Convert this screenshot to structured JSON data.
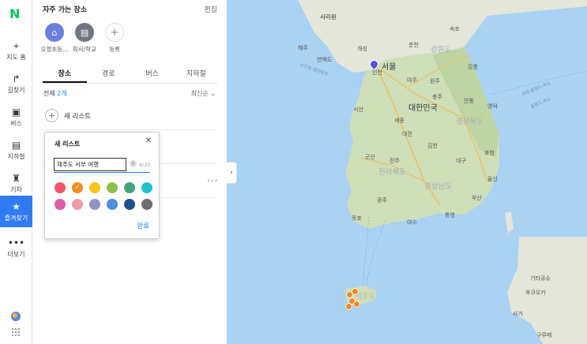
{
  "brand": {
    "logo": "N",
    "color": "#03c75a"
  },
  "rail": {
    "items": [
      {
        "icon": "map-pin-icon",
        "label": "지도 홈",
        "glyph": "⌖"
      },
      {
        "icon": "directions-icon",
        "label": "길찾기",
        "glyph": "↱"
      },
      {
        "icon": "bus-icon",
        "label": "버스",
        "glyph": "▣"
      },
      {
        "icon": "subway-icon",
        "label": "지하철",
        "glyph": "▤"
      },
      {
        "icon": "train-icon",
        "label": "기차",
        "glyph": "♜"
      },
      {
        "icon": "star-icon",
        "label": "즐겨찾기",
        "glyph": "★"
      },
      {
        "icon": "more-icon",
        "label": "더보기",
        "glyph": "•••"
      }
    ],
    "active_index": 5,
    "accent": "#2f7bf5"
  },
  "panel": {
    "title": "자주 가는 장소",
    "edit_label": "편집",
    "favorites": [
      {
        "label": "오정초등...",
        "icon": "home-icon",
        "glyph": "⌂",
        "color": "#6b7fe0"
      },
      {
        "label": "회사/학교",
        "icon": "building-icon",
        "glyph": "▤",
        "color": "#6f7680"
      },
      {
        "label": "등록",
        "icon": "add-icon",
        "glyph": "+",
        "color": "#ffffff"
      }
    ],
    "tabs": [
      "장소",
      "경로",
      "버스",
      "지하철"
    ],
    "active_tab": 0,
    "count_prefix": "전체 ",
    "count_value": "2개",
    "sort_label": "최신순 ⌄",
    "new_list_label": "새 리스트"
  },
  "dialog": {
    "title": "새 리스트",
    "input_value": "제주도 서부 여행",
    "char_count": "9/20",
    "done_label": "완료",
    "colors": [
      "#f2556a",
      "#f58a1f",
      "#f5c518",
      "#8bc34a",
      "#43a37a",
      "#1ec3cf",
      "#e25aa8",
      "#f29aa8",
      "#8e94c9",
      "#4a90e2",
      "#1f4f8f",
      "#6e6e6e"
    ],
    "selected_color": 1
  },
  "map": {
    "labels": {
      "sariwon": "사리원",
      "haeju": "해주",
      "gaeseong": "개성",
      "yeonbaek": "연백도",
      "seoul": "서울",
      "incheon": "인천",
      "chuncheon": "춘천",
      "sokcho": "속초",
      "gangwondo": "강원도",
      "gangneung": "강릉",
      "wonju": "원주",
      "yeoju": "여주",
      "korea": "대한민국",
      "seosan": "서산",
      "chungju": "충주",
      "sejong": "세종",
      "andong": "안동",
      "yeongdeok": "영덕",
      "daejeon": "대전",
      "gyeongsangbukdo": "경상북도",
      "gimcheon": "김천",
      "gunsan": "군산",
      "pohang": "포항",
      "jeonju": "전주",
      "jeollabukdo": "전라북도",
      "daegu": "대구",
      "gyeongsangnamdo": "경상남도",
      "ulsan": "울산",
      "gwangju": "광주",
      "busan": "부산",
      "mokpo": "목포",
      "yeosu": "여수",
      "tongyeong": "통영",
      "jejudo": "제주도",
      "kitakyushu": "기타큐슈",
      "fukuoka": "후쿠오카",
      "saga": "사가",
      "kurume": "구루메",
      "sea1": "인천항-옹진항로",
      "sea2": "포항-울릉도-독도",
      "sea3": "울릉도-독도"
    }
  }
}
